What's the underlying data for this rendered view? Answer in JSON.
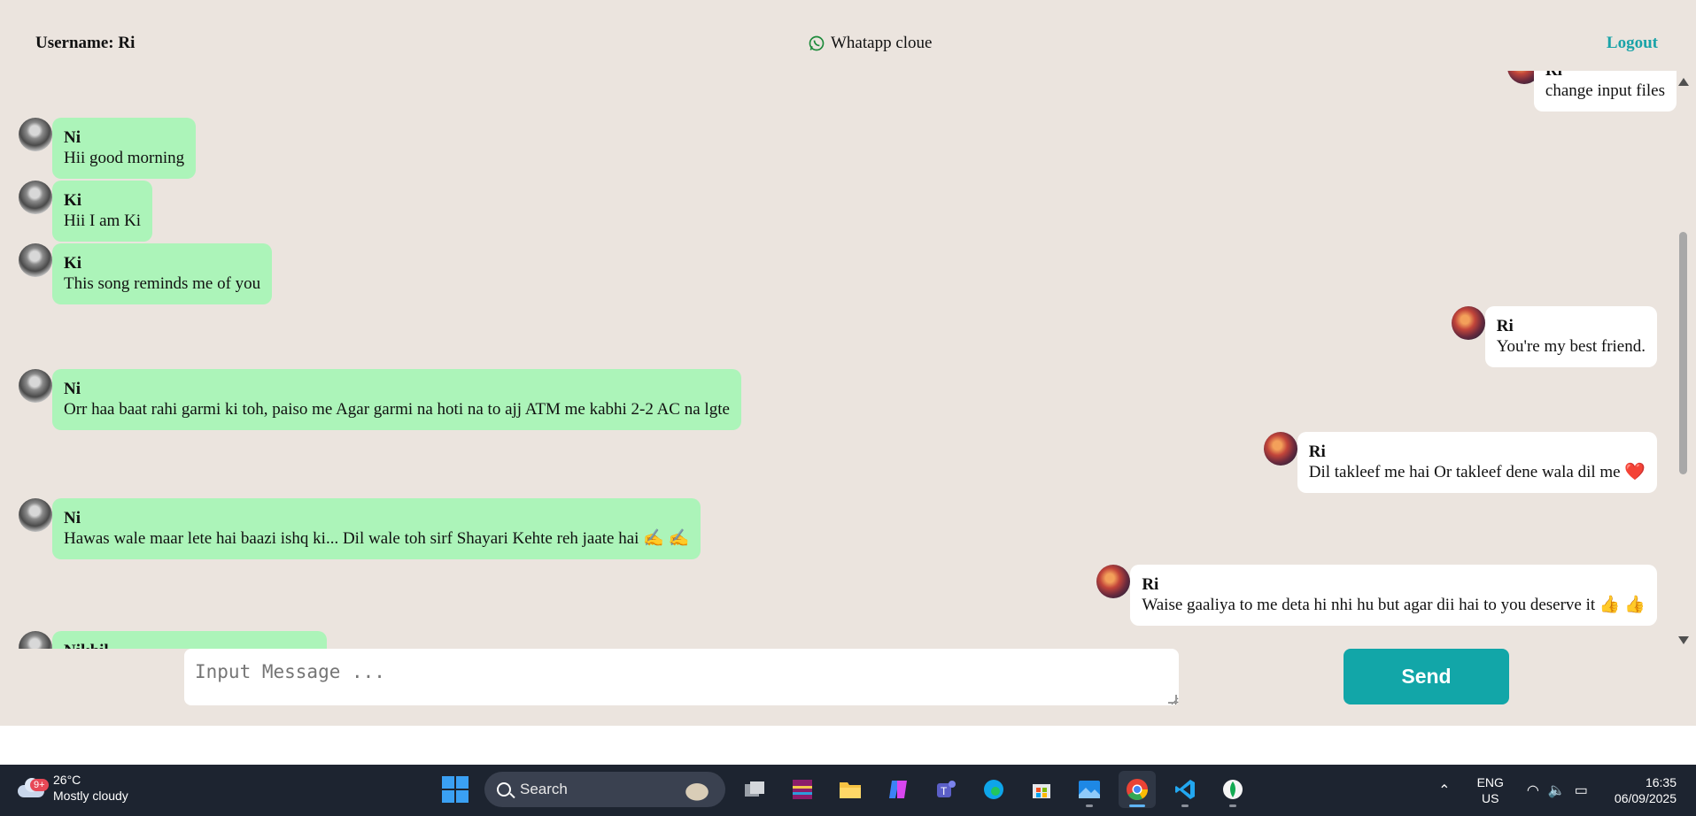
{
  "header": {
    "username": "Username: Ri",
    "brand": "Whatapp cloue",
    "logout": "Logout"
  },
  "messages": [
    {
      "side": "out",
      "sender": "Ri",
      "text": "change input files"
    },
    {
      "side": "in",
      "sender": "Ni",
      "text": "Hii good morning"
    },
    {
      "side": "in",
      "sender": "Ki",
      "text": "Hii I am Ki"
    },
    {
      "side": "in",
      "sender": "Ki",
      "text": "This song reminds me of you"
    },
    {
      "side": "out",
      "sender": "Ri",
      "text": "You're my best friend."
    },
    {
      "side": "in",
      "sender": "Ni",
      "text": "Orr haa baat rahi garmi ki toh, paiso me Agar garmi na hoti na to ajj ATM me kabhi 2-2 AC na lgte"
    },
    {
      "side": "out",
      "sender": "Ri",
      "text": "Dil takleef me hai Or takleef dene wala dil me ❤️"
    },
    {
      "side": "in",
      "sender": "Ni",
      "text": "Hawas wale maar lete hai baazi ishq ki... Dil wale toh sirf Shayari Kehte reh jaate hai ✍️ ✍️"
    },
    {
      "side": "out",
      "sender": "Ri",
      "text": "Waise gaaliya to me deta hi nhi hu but agar dii hai to you deserve it 👍 👍"
    },
    {
      "side": "in",
      "sender": "Nikhil",
      "text": ""
    }
  ],
  "composer": {
    "placeholder": "Input Message ...",
    "send_label": "Send"
  },
  "taskbar": {
    "weather_badge": "9+",
    "temperature": "26°C",
    "condition": "Mostly cloudy",
    "search_label": "Search",
    "lang_top": "ENG",
    "lang_bottom": "US",
    "time": "16:35",
    "date": "06/09/2025"
  },
  "colors": {
    "background": "#ebe4de",
    "incoming_bubble": "#acf4b9",
    "outgoing_bubble": "#ffffff",
    "accent": "#12a6a8"
  }
}
